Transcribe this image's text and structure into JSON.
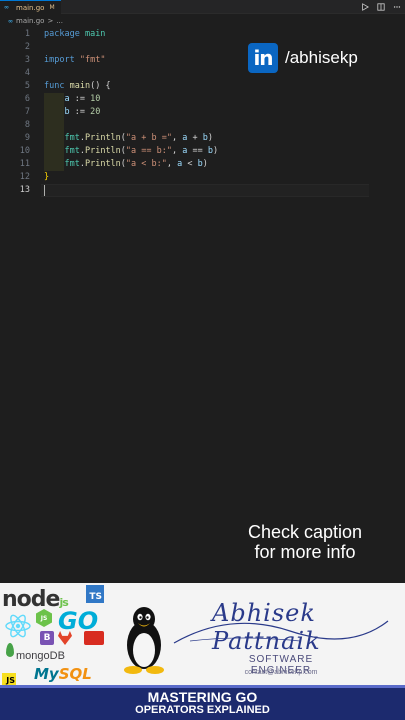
{
  "tab": {
    "icon": "go-file-icon",
    "label": "main.go",
    "modified": "M"
  },
  "breadcrumb": {
    "file": "main.go",
    "sep": ">",
    "more": "..."
  },
  "toolbar": {
    "icons": [
      "run-icon",
      "split-editor-icon",
      "more-actions-icon"
    ]
  },
  "editor": {
    "lines": [
      {
        "num": "1",
        "text": "package main"
      },
      {
        "num": "2",
        "text": ""
      },
      {
        "num": "3",
        "text": "import \"fmt\""
      },
      {
        "num": "4",
        "text": ""
      },
      {
        "num": "5",
        "text": "func main() {"
      },
      {
        "num": "6",
        "text": "    a := 10"
      },
      {
        "num": "7",
        "text": "    b := 20"
      },
      {
        "num": "8",
        "text": ""
      },
      {
        "num": "9",
        "text": "    fmt.Println(\"a + b =\", a + b)"
      },
      {
        "num": "10",
        "text": "    fmt.Println(\"a == b:\", a == b)"
      },
      {
        "num": "11",
        "text": "    fmt.Println(\"a < b:\", a < b)"
      },
      {
        "num": "12",
        "text": "}"
      },
      {
        "num": "13",
        "text": ""
      }
    ],
    "current_line": "13"
  },
  "overlay": {
    "linkedin_logo": "in",
    "linkedin_handle": "/abhisekp",
    "caption_line1": "Check caption",
    "caption_line2": "for more info"
  },
  "banner": {
    "logos": {
      "node": "node",
      "node_js": "js",
      "ts": "TS",
      "go": "GO",
      "bootstrap": "B",
      "mongodb": "mongoDB",
      "js": "JS",
      "mysql": "My",
      "mysql_sql": "SQL"
    },
    "signature": "Abhisek Pattnaik",
    "role": "SOFTWARE ENGINEER",
    "contact": "contact@abhisekp.com",
    "title_line1": "MASTERING GO",
    "title_line2": "OPERATORS EXPLAINED"
  },
  "colors": {
    "editor_bg": "#1e1e1e",
    "keyword": "#569cd6",
    "string": "#ce9178",
    "linkedin": "#0a66c2",
    "title_bar": "#1c2a6e"
  }
}
